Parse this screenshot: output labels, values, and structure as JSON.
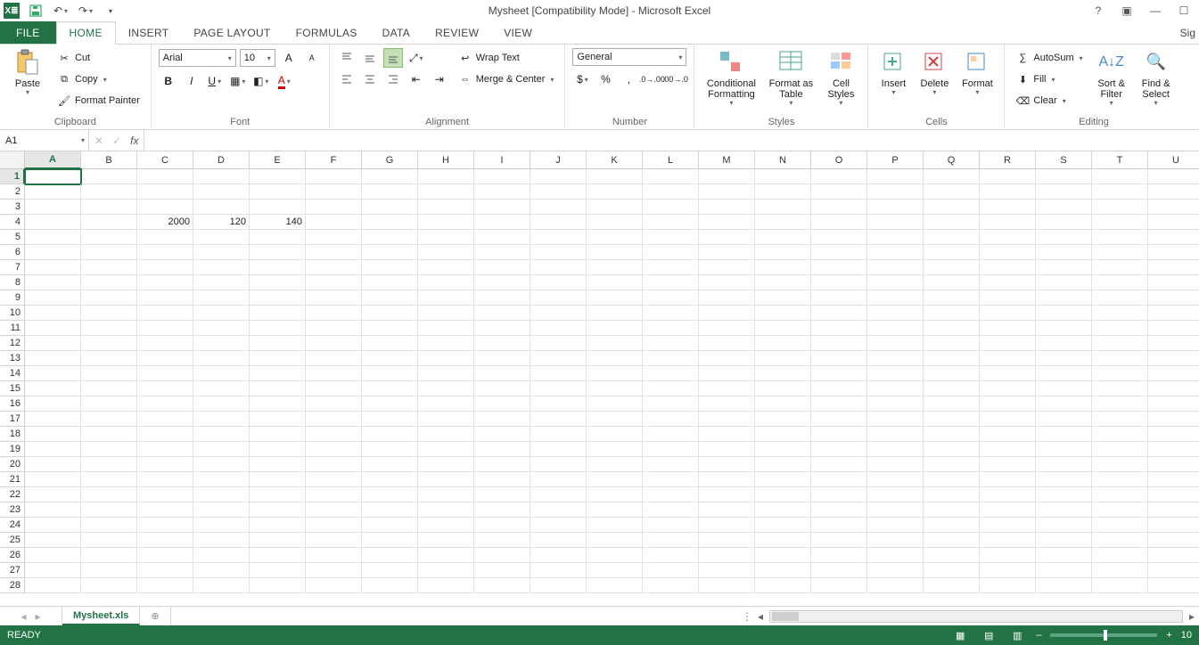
{
  "title": "Mysheet  [Compatibility Mode] - Microsoft Excel",
  "qat": {
    "undo": "↶",
    "redo": "↷"
  },
  "win": {
    "signin_short": "Sig"
  },
  "tabs": {
    "file": "FILE",
    "items": [
      "HOME",
      "INSERT",
      "PAGE LAYOUT",
      "FORMULAS",
      "DATA",
      "REVIEW",
      "VIEW"
    ],
    "active": "HOME"
  },
  "ribbon": {
    "clipboard": {
      "label": "Clipboard",
      "paste": "Paste",
      "cut": "Cut",
      "copy": "Copy",
      "fpaint": "Format Painter"
    },
    "font": {
      "label": "Font",
      "name": "Arial",
      "size": "10",
      "b": "B",
      "i": "I",
      "u": "U"
    },
    "alignment": {
      "label": "Alignment",
      "wrap": "Wrap Text",
      "merge": "Merge & Center"
    },
    "number": {
      "label": "Number",
      "format": "General",
      "pct": "%",
      "comma": ","
    },
    "styles": {
      "label": "Styles",
      "cf": "Conditional Formatting",
      "fat": "Format as Table",
      "cs": "Cell Styles"
    },
    "cells": {
      "label": "Cells",
      "insert": "Insert",
      "delete": "Delete",
      "format": "Format"
    },
    "editing": {
      "label": "Editing",
      "autosum": "AutoSum",
      "fill": "Fill",
      "clear": "Clear",
      "sort": "Sort & Filter",
      "find": "Find & Select"
    }
  },
  "fbar": {
    "name": "A1",
    "fx": "fx",
    "formula": ""
  },
  "grid": {
    "cols": [
      "A",
      "B",
      "C",
      "D",
      "E",
      "F",
      "G",
      "H",
      "I",
      "J",
      "K",
      "L",
      "M",
      "N",
      "O",
      "P",
      "Q",
      "R",
      "S",
      "T",
      "U"
    ],
    "rows": 28,
    "active_col": "A",
    "active_row": 1,
    "data": {
      "C4": "2000",
      "D4": "120",
      "E4": "140"
    }
  },
  "sheets": {
    "active": "Mysheet.xls",
    "items": [
      "Mysheet.xls"
    ]
  },
  "status": {
    "ready": "READY",
    "zoom": "10"
  }
}
